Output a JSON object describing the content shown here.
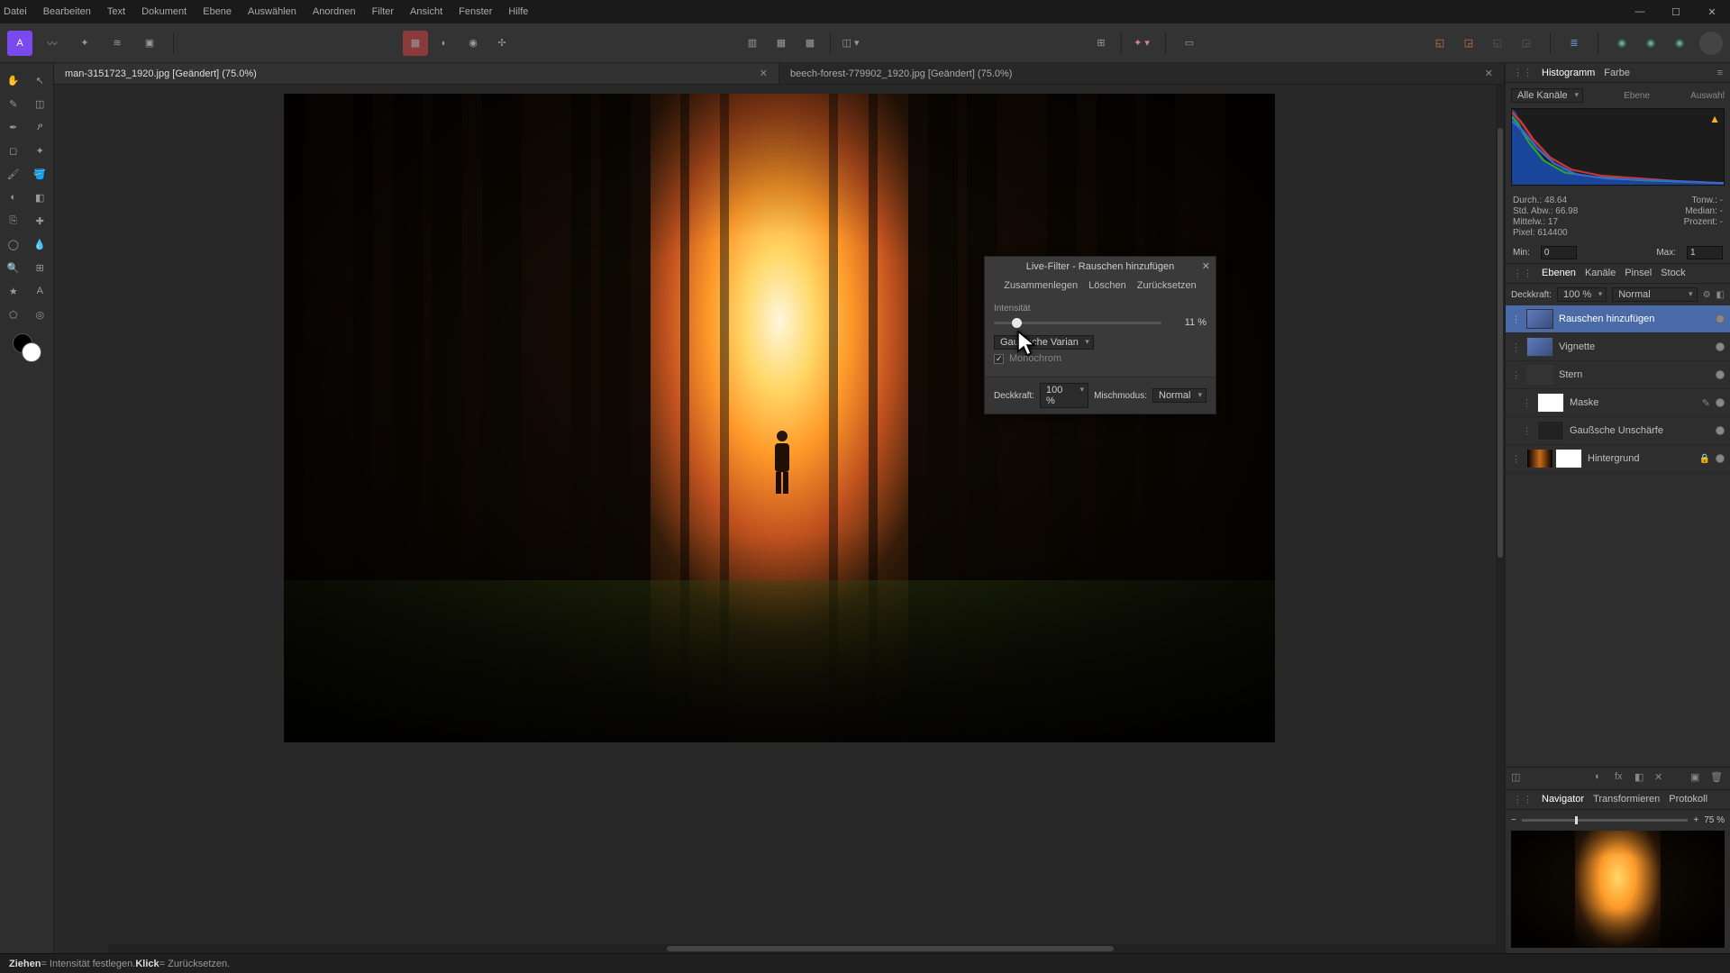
{
  "menu": [
    "Datei",
    "Bearbeiten",
    "Text",
    "Dokument",
    "Ebene",
    "Auswählen",
    "Anordnen",
    "Filter",
    "Ansicht",
    "Fenster",
    "Hilfe"
  ],
  "tabs": [
    {
      "label": "man-3151723_1920.jpg [Geändert] (75.0%)",
      "active": true
    },
    {
      "label": "beech-forest-779902_1920.jpg [Geändert] (75.0%)",
      "active": false
    }
  ],
  "dialog": {
    "title": "Live-Filter - Rauschen hinzufügen",
    "actions": [
      "Zusammenlegen",
      "Löschen",
      "Zurücksetzen"
    ],
    "intensity_label": "Intensität",
    "intensity_value": "11 %",
    "intensity_pct": 11,
    "dist_label": "Gauß'sche Varian",
    "mono_label": "Monochrom",
    "opacity_label": "Deckkraft:",
    "opacity_value": "100 %",
    "blend_label": "Mischmodus:",
    "blend_value": "Normal"
  },
  "right": {
    "tabs_top": [
      "Histogramm",
      "Farbe"
    ],
    "histo_channel": "Alle Kanäle",
    "histo_right_labels": [
      "Ebene",
      "Auswahl"
    ],
    "stats": {
      "durch": "Durch.: 48.64",
      "tonw": "Tonw.: -",
      "std": "Std. Abw.: 66.98",
      "median": "Median: -",
      "mittelw": "Mittelw.: 17",
      "prozent": "Prozent: -",
      "pixel": "Pixel: 614400"
    },
    "min_label": "Min:",
    "min_val": "0",
    "max_label": "Max:",
    "max_val": "1",
    "subtabs": [
      "Ebenen",
      "Kanäle",
      "Pinsel",
      "Stock"
    ],
    "layer_opacity_label": "Deckkraft:",
    "layer_opacity_val": "100 %",
    "layer_blend": "Normal",
    "layers": [
      {
        "name": "Rauschen hinzufügen",
        "sel": true,
        "thumb": "fx"
      },
      {
        "name": "Vignette",
        "thumb": "fx"
      },
      {
        "name": "Stern",
        "thumb": "fx"
      },
      {
        "name": "Maske",
        "thumb": "mask",
        "indent": true,
        "edit": true
      },
      {
        "name": "Gaußsche Unschärfe",
        "thumb": "fx",
        "indent": true
      },
      {
        "name": "Hintergrund",
        "thumb": "img",
        "dual": true,
        "lock": true
      }
    ],
    "nav_tabs": [
      "Navigator",
      "Transformieren",
      "Protokoll"
    ],
    "zoom": "75 %"
  },
  "status": {
    "drag_label": "Ziehen",
    "drag_desc": " = Intensität festlegen. ",
    "click_label": "Klick",
    "click_desc": " = Zurücksetzen."
  }
}
